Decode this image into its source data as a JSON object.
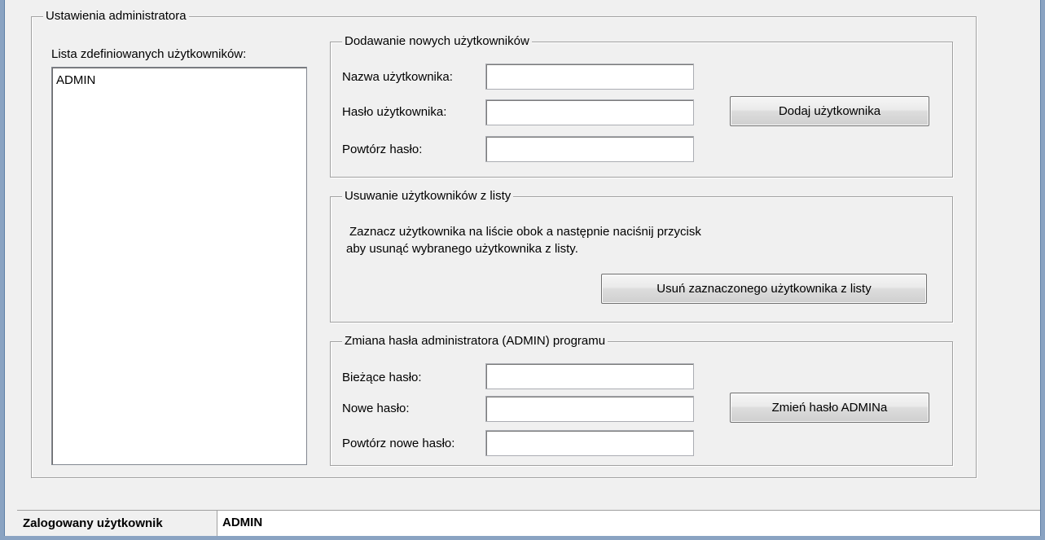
{
  "admin_group": {
    "title": "Ustawienia administratora",
    "users_list_label": "Lista zdefiniowanych użytkowników:",
    "users": [
      "ADMIN"
    ]
  },
  "add_user": {
    "title": "Dodawanie nowych użytkowników",
    "username_label": "Nazwa użytkownika:",
    "username_value": "",
    "password_label": "Hasło użytkownika:",
    "password_value": "",
    "repeat_label": "Powtórz hasło:",
    "repeat_value": "",
    "button": "Dodaj użytkownika"
  },
  "remove_user": {
    "title": "Usuwanie użytkowników z listy",
    "description_line1": "Zaznacz użytkownika na liście obok a następnie naciśnij przycisk",
    "description_line2": "aby usunąć wybranego użytkownika z listy.",
    "button": "Usuń zaznaczonego użytkownika z listy"
  },
  "change_admin_password": {
    "title": "Zmiana hasła administratora (ADMIN) programu",
    "current_label": "Bieżące hasło:",
    "current_value": "",
    "new_label": "Nowe hasło:",
    "new_value": "",
    "repeat_label": "Powtórz nowe hasło:",
    "repeat_value": "",
    "button": "Zmień hasło ADMINa"
  },
  "status": {
    "label": "Zalogowany użytkownik",
    "value": "ADMIN"
  }
}
